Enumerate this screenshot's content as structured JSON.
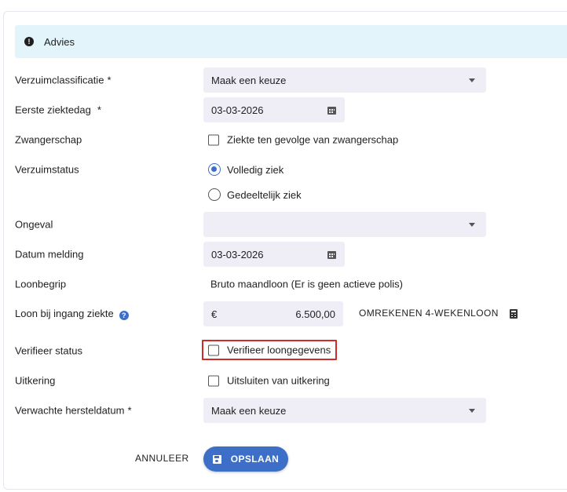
{
  "alert": {
    "text": "Advies"
  },
  "form": {
    "verzuimclassificatie": {
      "label": "Verzuimclassificatie",
      "required": "*",
      "value": "Maak een keuze"
    },
    "eerste_ziektedag": {
      "label": "Eerste ziektedag",
      "required": "*",
      "value": "03-03-2026"
    },
    "zwangerschap": {
      "label": "Zwangerschap",
      "checkbox_label": "Ziekte ten gevolge van zwangerschap",
      "checked": false
    },
    "verzuimstatus": {
      "label": "Verzuimstatus",
      "options": [
        {
          "label": "Volledig ziek",
          "selected": true
        },
        {
          "label": "Gedeeltelijk ziek",
          "selected": false
        }
      ]
    },
    "ongeval": {
      "label": "Ongeval",
      "value": ""
    },
    "datum_melding": {
      "label": "Datum melding",
      "value": "03-03-2026"
    },
    "loonbegrip": {
      "label": "Loonbegrip",
      "value": "Bruto maandloon (Er is geen actieve polis)"
    },
    "loon_bij_ingang": {
      "label": "Loon bij ingang ziekte",
      "help_icon": "?",
      "currency": "€",
      "value": "6.500,00",
      "recalc_label": "OMREKENEN 4-WEKENLOON"
    },
    "verifieer_status": {
      "label": "Verifieer status",
      "checkbox_label": "Verifieer loongegevens",
      "checked": false
    },
    "uitkering": {
      "label": "Uitkering",
      "checkbox_label": "Uitsluiten van uitkering",
      "checked": false
    },
    "verwachte_hersteldatum": {
      "label": "Verwachte hersteldatum",
      "required": "*",
      "value": "Maak een keuze"
    }
  },
  "actions": {
    "cancel_label": "ANNULEER",
    "save_label": "OPSLAAN"
  },
  "colors": {
    "primary": "#3d6fc8",
    "alert_bg": "#e3f4fb",
    "field_bg": "#efeef7",
    "highlight": "#d12a2a"
  }
}
